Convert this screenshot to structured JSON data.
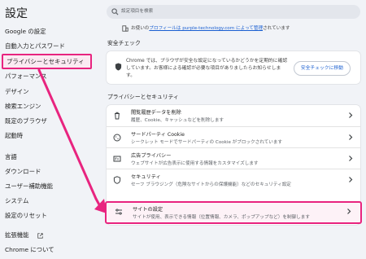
{
  "app": {
    "title": "設定"
  },
  "search": {
    "placeholder": "設定項目を検索"
  },
  "sidebar": {
    "items": [
      {
        "label": "Google の設定"
      },
      {
        "label": "自動入力とパスワード"
      },
      {
        "label": "プライバシーとセキュリティ",
        "highlighted": true
      },
      {
        "label": "パフォーマンス"
      },
      {
        "label": "デザイン"
      },
      {
        "label": "検索エンジン"
      },
      {
        "label": "既定のブラウザ"
      },
      {
        "label": "起動時"
      },
      {
        "label": "言語"
      },
      {
        "label": "ダウンロード"
      },
      {
        "label": "ユーザー補助機能"
      },
      {
        "label": "システム"
      },
      {
        "label": "設定のリセット"
      },
      {
        "label": "拡張機能"
      },
      {
        "label": "Chrome について"
      }
    ]
  },
  "notice": {
    "prefix": "お使いの",
    "link": "プロフィールは purple-technology.com によって管理",
    "suffix": "されています"
  },
  "safety_check": {
    "heading": "安全チェック",
    "text": "Chrome では、ブラウザが安全な設定になっているかどうかを定期的に確認しています。お客様による確認が必要な項目がありましたらお知らせします。",
    "button": "安全チェックに移動"
  },
  "privacy": {
    "heading": "プライバシーとセキュリティ",
    "rows": [
      {
        "title": "閲覧履歴データを削除",
        "subtitle": "履歴、Cookie、キャッシュなどを削除します",
        "icon": "trash-icon"
      },
      {
        "title": "サードパーティ Cookie",
        "subtitle": "シークレット モードでサードパーティの Cookie がブロックされています",
        "icon": "cookie-icon"
      },
      {
        "title": "広告プライバシー",
        "subtitle": "ウェブサイトが広告表示に使用する情報をカスタマイズします",
        "icon": "ad-icon"
      },
      {
        "title": "セキュリティ",
        "subtitle": "セーフ ブラウジング（危険なサイトからの保護機能）などのセキュリティ設定",
        "icon": "shield-icon"
      },
      {
        "title": "サイトの設定",
        "subtitle": "サイトが使用、表示できる情報（位置情報、カメラ、ポップアップなど）を制御します",
        "icon": "sliders-icon",
        "highlighted": true
      }
    ]
  },
  "colors": {
    "accent": "#1a5fd1",
    "highlight": "#e8247f",
    "background": "#f1f3f7"
  }
}
